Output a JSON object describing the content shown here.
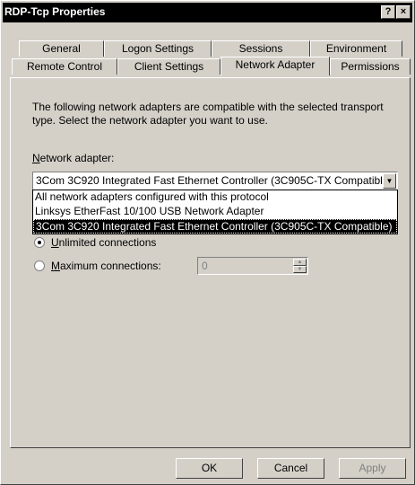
{
  "window": {
    "title": "RDP-Tcp Properties",
    "help_label": "?",
    "close_label": "×"
  },
  "tabs": {
    "row_back": [
      "General",
      "Logon Settings",
      "Sessions",
      "Environment"
    ],
    "row_front": [
      "Remote Control",
      "Client Settings",
      "Network Adapter",
      "Permissions"
    ],
    "active": "Network Adapter"
  },
  "panel": {
    "description": "The following network adapters are compatible with the selected transport type. Select the network adapter you want to use.",
    "adapter_label_accel": "N",
    "adapter_label_rest": "etwork adapter:",
    "combo_value": "3Com 3C920 Integrated Fast Ethernet Controller (3C905C-TX Compatible)",
    "options": [
      "All network adapters configured with this protocol",
      "Linksys EtherFast 10/100 USB Network Adapter",
      "3Com 3C920 Integrated Fast Ethernet Controller (3C905C-TX Compatible)"
    ],
    "selected_option_index": 2,
    "unlimited_accel": "U",
    "unlimited_rest": "nlimited connections",
    "maximum_accel": "M",
    "maximum_rest": "aximum connections:",
    "maximum_value": "0",
    "unlimited_selected": true
  },
  "buttons": {
    "ok": "OK",
    "cancel": "Cancel",
    "apply": "Apply"
  },
  "colors": {
    "face": "#d4d0c8",
    "titlebar": "#000000",
    "selection": "#000000"
  }
}
